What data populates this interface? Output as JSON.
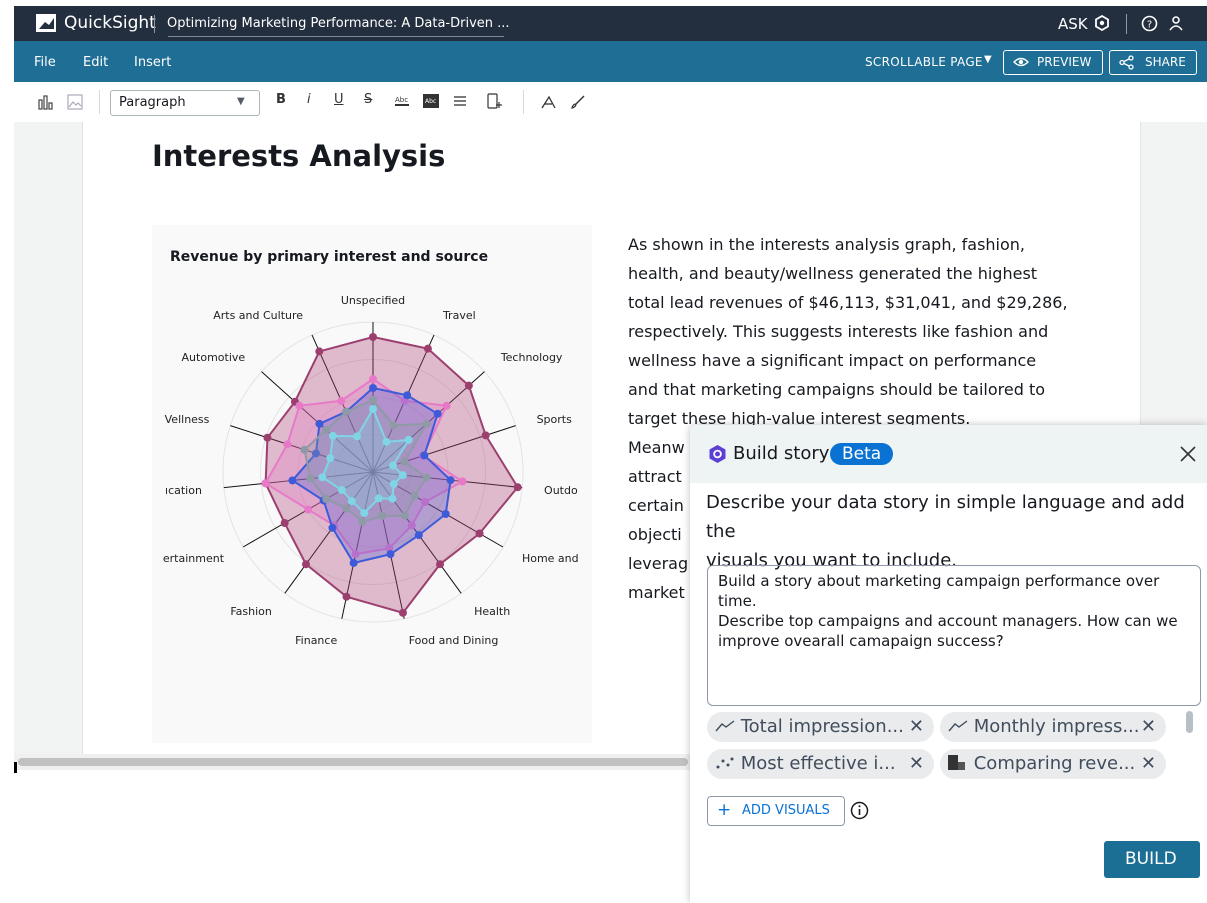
{
  "app": {
    "name": "QuickSight",
    "doc_title": "Optimizing Marketing Performance: A Data-Driven ...",
    "ask_label": "ASK"
  },
  "menu": {
    "file": "File",
    "edit": "Edit",
    "insert": "Insert",
    "scroll_mode": "SCROLLABLE PAGE",
    "preview": "PREVIEW",
    "share": "SHARE"
  },
  "toolbar": {
    "paragraph_select": "Paragraph",
    "bold": "B",
    "italic": "i",
    "underline": "U",
    "strike": "S"
  },
  "page": {
    "heading": "Interests Analysis",
    "paragraph_lines": [
      "As shown in the interests analysis graph, fashion,",
      "health, and beauty/wellness generated the highest",
      "total lead revenues of $46,113, $31,041, and $29,286,",
      "respectively. This suggests interests like fashion and",
      "wellness have a significant impact on performance",
      "and that marketing campaigns should be tailored to",
      "target these high-value interest segments.",
      "Meanw",
      "attract",
      "certain",
      "objecti",
      "leverag",
      "market"
    ]
  },
  "chart_data": {
    "type": "radar",
    "title": "Revenue by primary interest and source",
    "categories": [
      "Unspecified",
      "Travel",
      "Technology",
      "Sports",
      "Outdo",
      "Home and",
      "Health",
      "Food and Dining",
      "Finance",
      "Fashion",
      "ertainment",
      "ıcation",
      "Vellness",
      "Automotive",
      "Arts and Culture"
    ],
    "rmax": 1.0,
    "series": [
      {
        "color": "#9c3f6e",
        "fill": "rgba(176,70,120,0.35)",
        "values": [
          0.9,
          0.9,
          0.86,
          0.79,
          0.97,
          0.82,
          0.76,
          0.96,
          0.85,
          0.76,
          0.68,
          0.72,
          0.74,
          0.7,
          0.88
        ]
      },
      {
        "color": "#e879c9",
        "fill": "rgba(232,121,201,0.30)",
        "values": [
          0.62,
          0.52,
          0.66,
          0.35,
          0.6,
          0.4,
          0.44,
          0.52,
          0.56,
          0.44,
          0.5,
          0.72,
          0.6,
          0.66,
          0.52
        ]
      },
      {
        "color": "#3d5bd9",
        "fill": "rgba(61,91,217,0.28)",
        "values": [
          0.56,
          0.56,
          0.58,
          0.36,
          0.52,
          0.56,
          0.52,
          0.56,
          0.62,
          0.46,
          0.38,
          0.54,
          0.4,
          0.48,
          0.44
        ]
      },
      {
        "color": "#8e9aa5",
        "fill": "rgba(142,154,165,0.30)",
        "values": [
          0.48,
          0.34,
          0.48,
          0.22,
          0.36,
          0.32,
          0.36,
          0.3,
          0.34,
          0.3,
          0.36,
          0.42,
          0.48,
          0.42,
          0.44
        ]
      },
      {
        "color": "#7fd4e6",
        "fill": "rgba(127,212,230,0.28)",
        "values": [
          0.42,
          0.22,
          0.32,
          0.14,
          0.2,
          0.16,
          0.22,
          0.18,
          0.28,
          0.24,
          0.24,
          0.34,
          0.3,
          0.36,
          0.26
        ]
      }
    ]
  },
  "dialog": {
    "title": "Build story",
    "badge": "Beta",
    "description_line1": "Describe your data story in simple language and add the",
    "description_line2": "visuals you want to include.",
    "prompt_line1": "Build a story about marketing campaign performance over time.",
    "prompt_line2": "Describe top campaigns and account managers.  How can we",
    "prompt_line3": "improve ovearall camapaign success?",
    "visuals": [
      {
        "label": "Total impression...",
        "icon": "line-chart-icon"
      },
      {
        "label": "Monthly impress...",
        "icon": "line-chart-icon"
      },
      {
        "label": "Most effective i...",
        "icon": "scatter-icon"
      },
      {
        "label": "Comparing reve...",
        "icon": "heatmap-icon"
      }
    ],
    "add_visuals": "ADD VISUALS",
    "build": "BUILD"
  }
}
